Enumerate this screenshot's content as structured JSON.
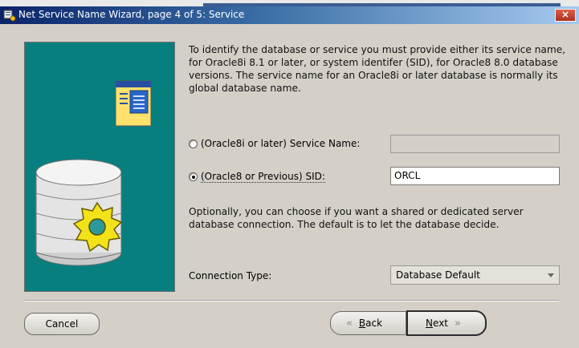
{
  "window": {
    "title": "Net Service Name Wizard, page 4 of 5: Service",
    "close_label": "×"
  },
  "intro_text": "To identify the database or service you must provide either its service name, for Oracle8i 8.1 or later, or system identifer (SID), for Oracle8 8.0 database versions. The service name for an Oracle8i or later database is normally its global database name.",
  "service_name_option": {
    "label": "(Oracle8i or later)  Service Name:",
    "selected": false,
    "value": ""
  },
  "sid_option": {
    "label": "(Oracle8 or Previous) SID:",
    "selected": true,
    "value": "ORCL"
  },
  "connection_text": "Optionally, you can choose if you want a shared or dedicated server database connection. The default is to let the database decide.",
  "connection_type": {
    "label": "Connection Type:",
    "value": "Database Default"
  },
  "buttons": {
    "cancel": "Cancel",
    "back_prefix": "",
    "back_accel": "B",
    "back_rest": "ack",
    "next_accel": "N",
    "next_rest": "ext"
  },
  "icons": {
    "window": "wizard-icon",
    "art": [
      "document-window-icon",
      "database-cylinder-icon",
      "gear-icon"
    ]
  },
  "colors": {
    "panel": "#087f7f",
    "title_bar": "#0a246a",
    "close_button": "#c84530"
  }
}
